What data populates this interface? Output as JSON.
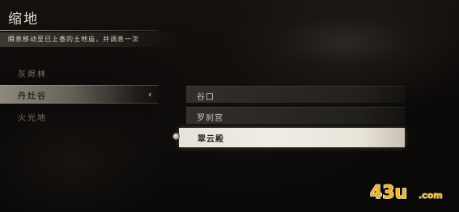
{
  "header": {
    "title": "缩地",
    "subtitle": "瞬息移动至已上香的土地庙，并调息一次"
  },
  "regions": [
    {
      "label": "灰烬林",
      "selected": false
    },
    {
      "label": "丹灶谷",
      "selected": true
    },
    {
      "label": "火光地",
      "selected": false
    }
  ],
  "destinations": [
    {
      "label": "谷口",
      "selected": false
    },
    {
      "label": "罗刹宫",
      "selected": false
    },
    {
      "label": "翠云殿",
      "selected": true
    }
  ],
  "watermark": {
    "text": "43u.com",
    "icon": "logo-43u"
  },
  "colors": {
    "highlight": "#f1ede5",
    "background": "#0b0a09",
    "watermark_gold": "#f0b21e"
  }
}
